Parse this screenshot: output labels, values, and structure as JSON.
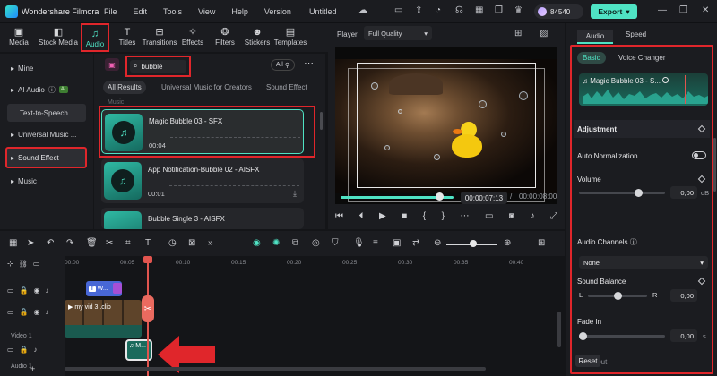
{
  "app": {
    "name": "Wondershare Filmora",
    "menu": [
      "File",
      "Edit",
      "Tools",
      "View",
      "Help",
      "Version"
    ],
    "document_title": "Untitled",
    "credits": "84540",
    "export_label": "Export"
  },
  "toolbar": {
    "items": [
      {
        "label": "Media",
        "icon": "media-icon"
      },
      {
        "label": "Stock Media",
        "icon": "stock-media-icon"
      },
      {
        "label": "Audio",
        "icon": "music-note-icon"
      },
      {
        "label": "Titles",
        "icon": "titles-icon"
      },
      {
        "label": "Transitions",
        "icon": "transitions-icon"
      },
      {
        "label": "Effects",
        "icon": "effects-icon"
      },
      {
        "label": "Filters",
        "icon": "filters-icon"
      },
      {
        "label": "Stickers",
        "icon": "stickers-icon"
      },
      {
        "label": "Templates",
        "icon": "templates-icon"
      }
    ],
    "active": "Audio"
  },
  "library_nav": {
    "items": [
      {
        "label": "Mine"
      },
      {
        "label": "AI Audio",
        "badge": "AI"
      },
      {
        "label": "Text-to-Speech"
      },
      {
        "label": "Universal Music ..."
      },
      {
        "label": "Sound Effect"
      },
      {
        "label": "Music"
      }
    ],
    "selected": "Sound Effect"
  },
  "library": {
    "search_value": "bubble",
    "filter_label": "All",
    "tabs": [
      "All Results",
      "Universal Music for Creators",
      "Sound Effect"
    ],
    "section_label": "Music",
    "results": [
      {
        "title": "Magic Bubble 03 - SFX",
        "duration": "00:04"
      },
      {
        "title": "App Notification-Bubble 02 - AISFX",
        "duration": "00:01"
      },
      {
        "title": "Bubble Single 3 - AISFX",
        "duration": ""
      }
    ]
  },
  "player": {
    "label": "Player",
    "quality": "Full Quality",
    "current_time": "00:00:07:13",
    "separator": "/",
    "total_time": "00:00:08:00",
    "progress_fraction": 0.93
  },
  "inspector": {
    "tabs": [
      "Audio",
      "Speed"
    ],
    "subtabs": [
      "Basic",
      "Voice Changer"
    ],
    "clip_name": "Magic Bubble 03 - S...",
    "adjustment_label": "Adjustment",
    "auto_normalization_label": "Auto Normalization",
    "volume": {
      "label": "Volume",
      "value": "0,00",
      "unit": "dB"
    },
    "channels": {
      "label": "Audio Channels",
      "value": "None"
    },
    "balance": {
      "label": "Sound Balance",
      "left": "L",
      "right": "R",
      "value": "0,00"
    },
    "fade_in": {
      "label": "Fade In",
      "value": "0,00",
      "unit": "s"
    },
    "fade_out_label": "Fade Out",
    "reset_label": "Reset"
  },
  "timeline": {
    "ruler": [
      "00:00",
      "00:05",
      "00:10",
      "00:15",
      "00:20",
      "00:25",
      "00:30",
      "00:35",
      "00:40"
    ],
    "tracks": [
      {
        "label": ""
      },
      {
        "label": "Video 1"
      },
      {
        "label": "Audio 1"
      }
    ],
    "title_clip_label": "W...",
    "title_clip_badge": "T",
    "video_clip_label": "my vid 3 .clip",
    "music_clip_label": "M..."
  },
  "colors": {
    "accent": "#4fe3c4",
    "highlight_box": "#e0262b",
    "playhead": "#e2554f",
    "background": "#1b1c20"
  }
}
